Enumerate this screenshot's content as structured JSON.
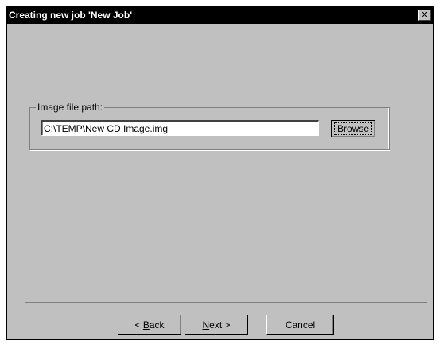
{
  "window": {
    "title": "Creating new job 'New Job'",
    "close_glyph": "✕"
  },
  "image_group": {
    "label": "Image file path:",
    "path_value": "C:\\TEMP\\New CD Image.img",
    "browse_label": "Browse"
  },
  "footer": {
    "back_mnemonic": "B",
    "back_rest": "ack",
    "back_prefix": "< ",
    "next_mnemonic": "N",
    "next_rest": "ext",
    "next_suffix": " >",
    "cancel_label": "Cancel"
  }
}
